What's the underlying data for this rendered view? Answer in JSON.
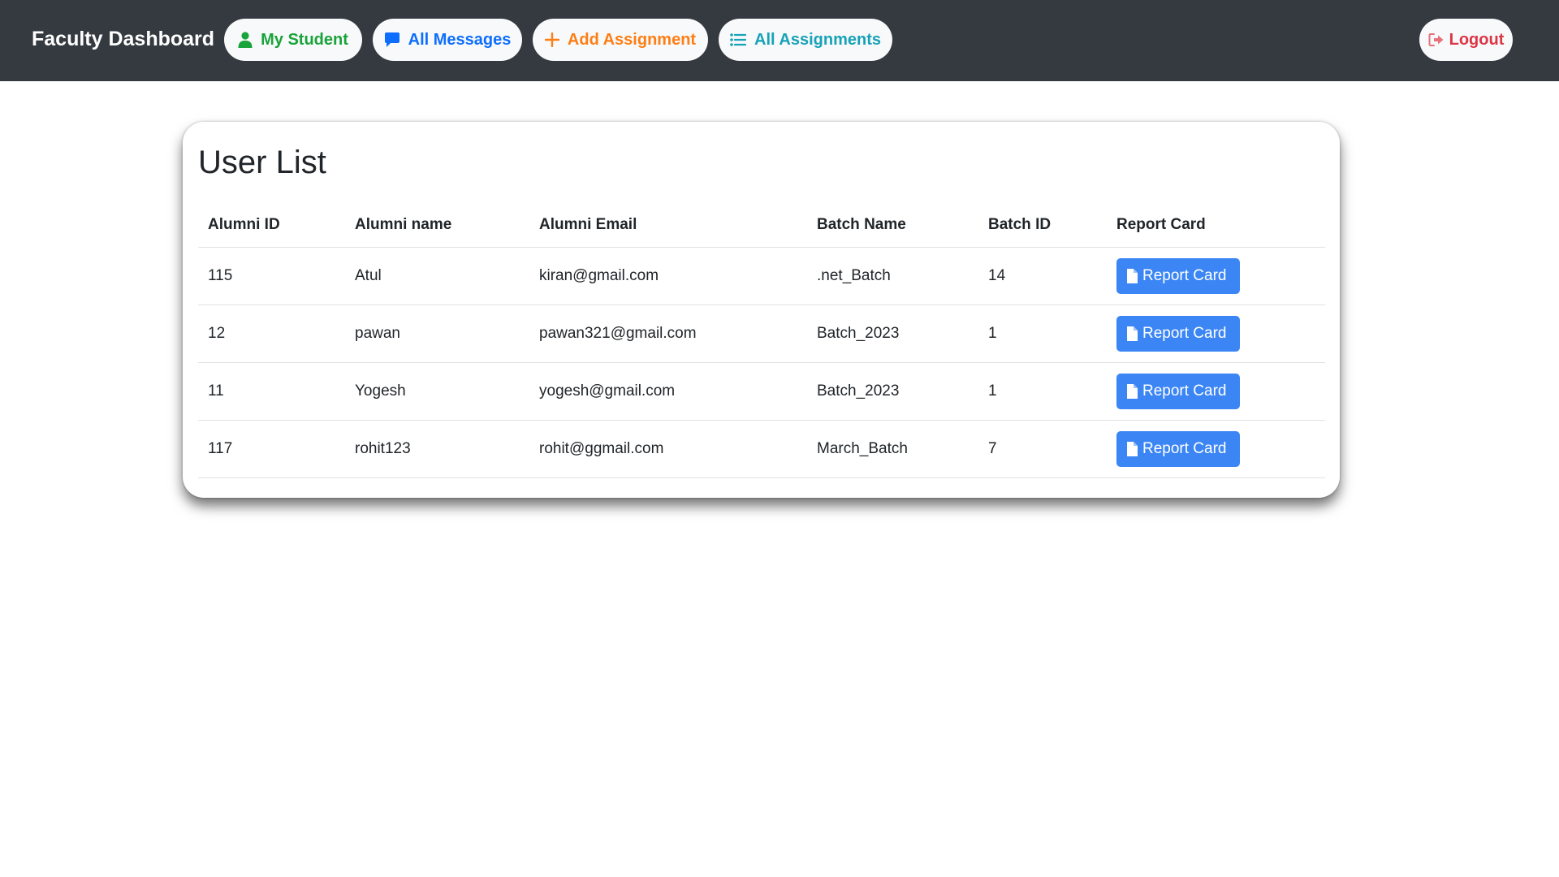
{
  "navbar": {
    "brand": "Faculty Dashboard",
    "items": [
      {
        "label": "My Student",
        "icon": "user-icon",
        "color": "#1aa33a"
      },
      {
        "label": "All Messages",
        "icon": "message-icon",
        "color": "#0d6efd"
      },
      {
        "label": "Add Assignment",
        "icon": "plus-icon",
        "color": "#fd7e14"
      },
      {
        "label": "All Assignments",
        "icon": "list-icon",
        "color": "#17a2b8"
      }
    ],
    "logout": {
      "label": "Logout",
      "icon": "logout-icon",
      "color": "#dc3545"
    }
  },
  "user_list": {
    "title": "User List",
    "columns": [
      "Alumni ID",
      "Alumni name",
      "Alumni Email",
      "Batch Name",
      "Batch ID",
      "Report Card"
    ],
    "button_label": "Report Card",
    "button_icon": "file-icon",
    "rows": [
      {
        "alumni_id": "115",
        "name": "Atul",
        "email": "kiran@gmail.com",
        "batch_name": ".net_Batch",
        "batch_id": "14"
      },
      {
        "alumni_id": "12",
        "name": "pawan",
        "email": "pawan321@gmail.com",
        "batch_name": "Batch_2023",
        "batch_id": "1"
      },
      {
        "alumni_id": "11",
        "name": "Yogesh",
        "email": "yogesh@gmail.com",
        "batch_name": "Batch_2023",
        "batch_id": "1"
      },
      {
        "alumni_id": "117",
        "name": "rohit123",
        "email": "rohit@ggmail.com",
        "batch_name": "March_Batch",
        "batch_id": "7"
      }
    ]
  },
  "colors": {
    "navbar_bg": "#343a40",
    "primary_button": "#3b86f4"
  }
}
